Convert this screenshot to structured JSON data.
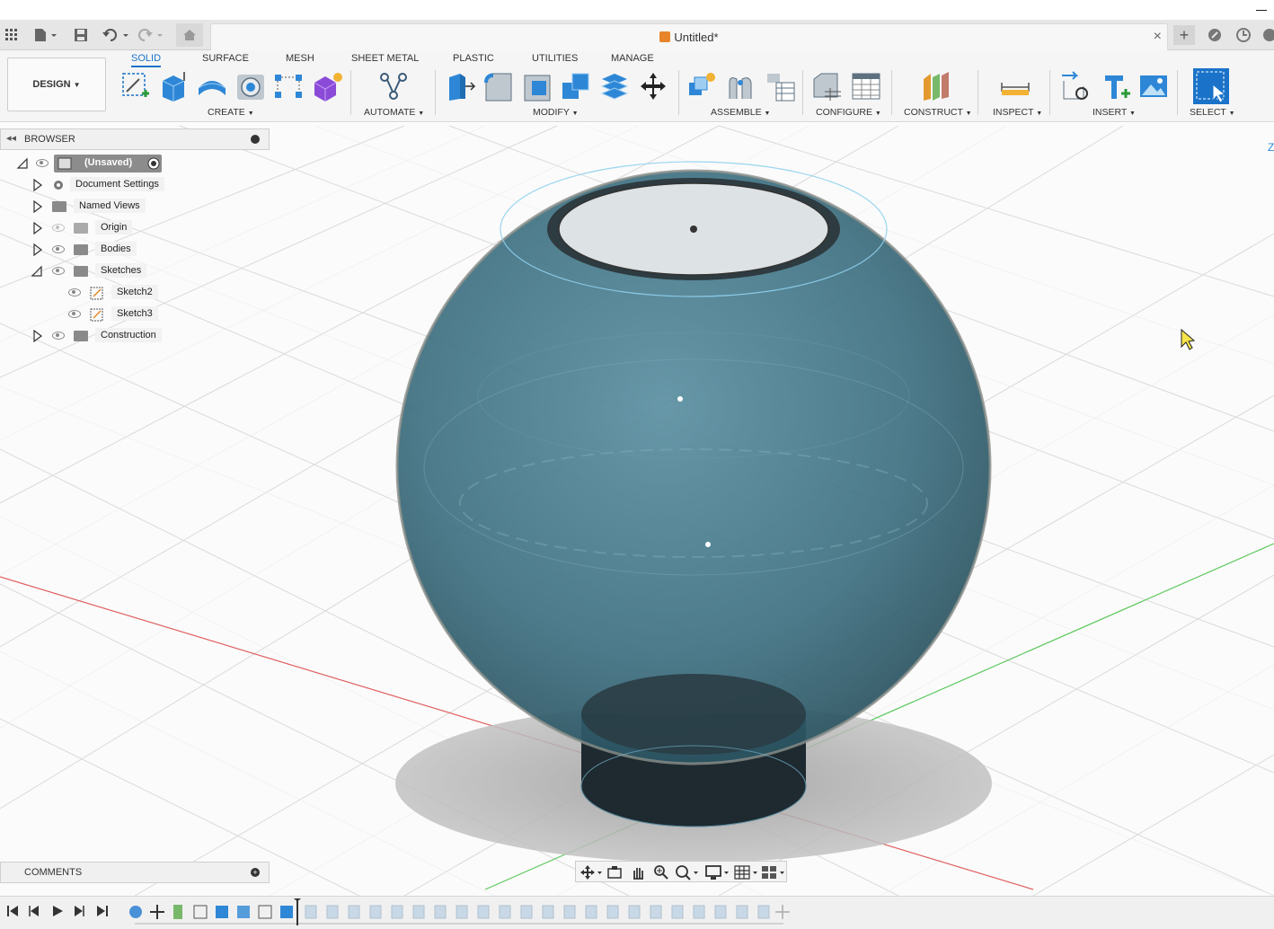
{
  "window": {
    "minimize_glyph": "—"
  },
  "quick_access": {
    "icons": [
      "app-grid-icon",
      "file-icon",
      "save-icon",
      "undo-icon",
      "redo-icon",
      "home-icon"
    ]
  },
  "document_tab": {
    "title": "Untitled*",
    "close": "×"
  },
  "tabbar_right": {
    "icons": [
      "new-tab-icon",
      "extensions-icon",
      "job-status-icon",
      "notifications-icon"
    ],
    "plus": "+"
  },
  "workspace": {
    "design_label": "DESIGN",
    "tabs": [
      "SOLID",
      "SURFACE",
      "MESH",
      "SHEET METAL",
      "PLASTIC",
      "UTILITIES",
      "MANAGE"
    ],
    "active_tab": "SOLID"
  },
  "toolbar_groups": {
    "create": "CREATE",
    "automate": "AUTOMATE",
    "modify": "MODIFY",
    "assemble": "ASSEMBLE",
    "configure": "CONFIGURE",
    "construct": "CONSTRUCT",
    "inspect": "INSPECT",
    "insert": "INSERT",
    "select": "SELECT"
  },
  "browser": {
    "title": "BROWSER",
    "root": "(Unsaved)",
    "items": [
      {
        "label": "Document Settings",
        "icon": "gear-icon"
      },
      {
        "label": "Named Views",
        "icon": "folder-icon"
      },
      {
        "label": "Origin",
        "icon": "folder-icon"
      },
      {
        "label": "Bodies",
        "icon": "folder-icon"
      },
      {
        "label": "Sketches",
        "icon": "folder-icon"
      },
      {
        "label": "Sketch2",
        "icon": "sketch-icon"
      },
      {
        "label": "Sketch3",
        "icon": "sketch-icon"
      },
      {
        "label": "Construction",
        "icon": "folder-icon"
      }
    ]
  },
  "comments": {
    "title": "COMMENTS"
  },
  "colors": {
    "accent": "#1a73c9",
    "sphere": "#3d6f80",
    "axis_x": "#e06060",
    "axis_y": "#5cc85c",
    "doc_icon": "#e8852a"
  },
  "navbar": {
    "icons": [
      "orbit-icon",
      "look-at-icon",
      "pan-icon",
      "zoom-icon",
      "fit-icon",
      "display-settings-icon",
      "grid-settings-icon",
      "viewports-icon"
    ]
  },
  "timeline": {
    "controls": [
      "first-icon",
      "previous-icon",
      "play-icon",
      "next-icon",
      "last-icon"
    ]
  }
}
